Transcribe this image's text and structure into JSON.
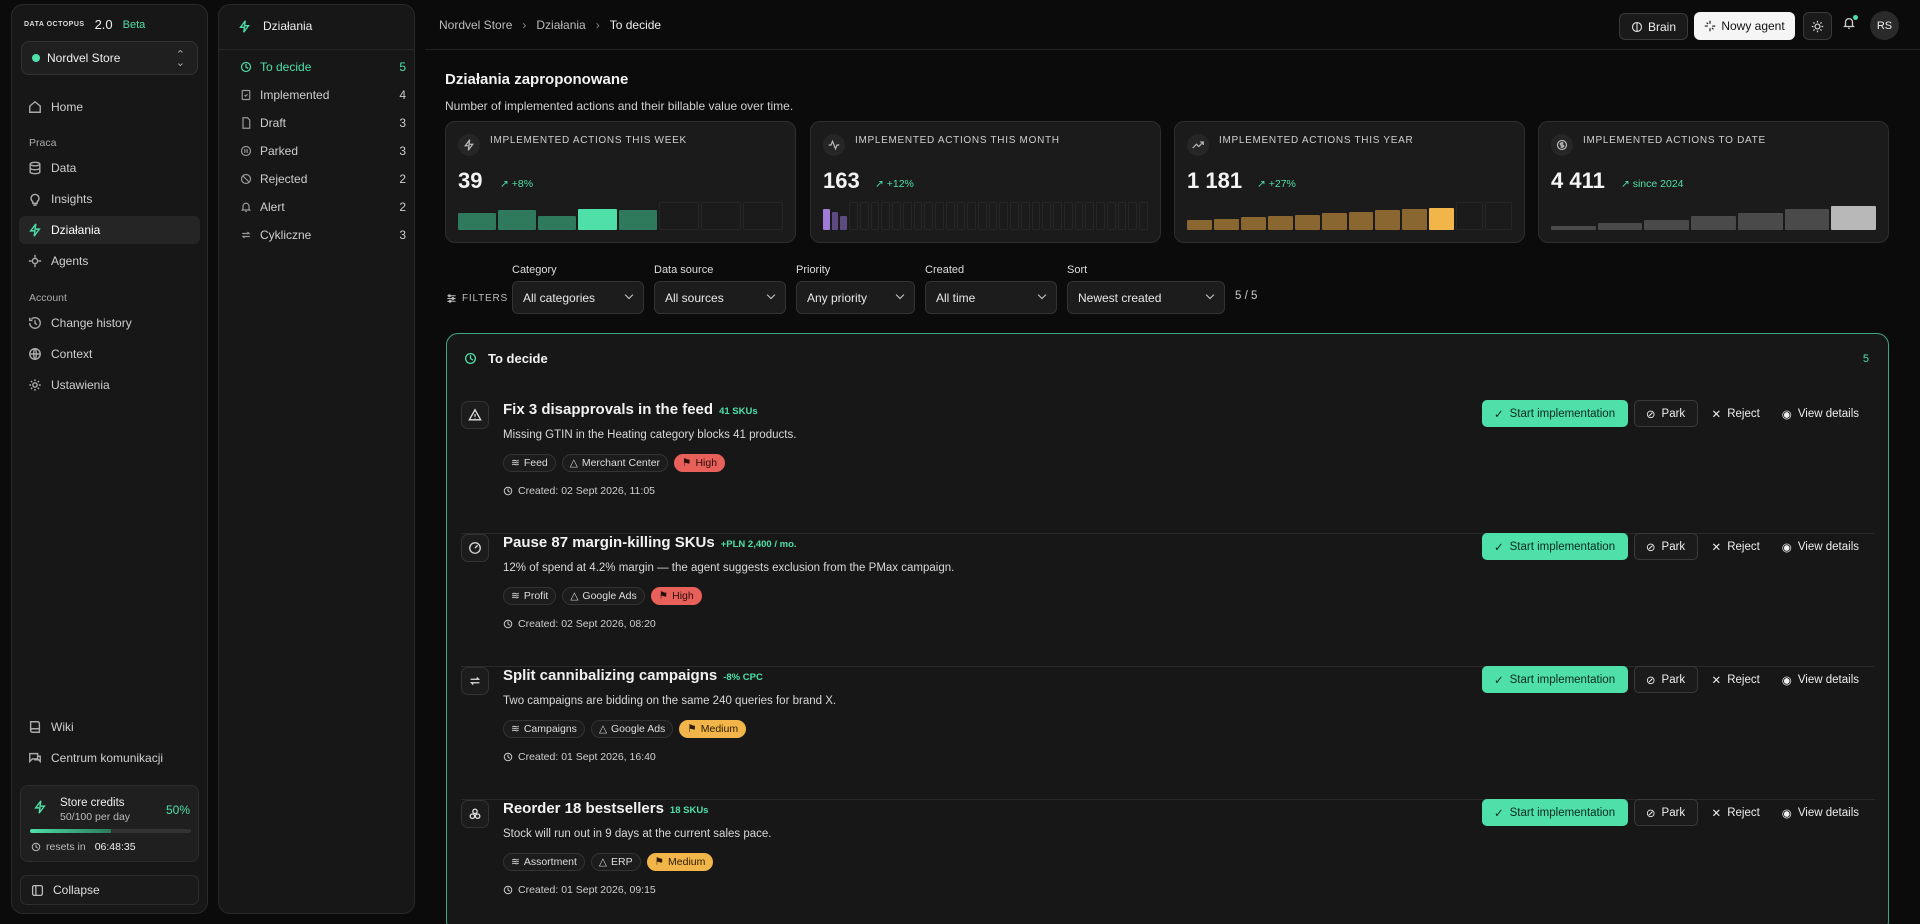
{
  "app": {
    "logo_text": "DATA OCTOPUS",
    "version": "2.0",
    "beta": "Beta",
    "store": "Nordvel Store"
  },
  "sidebar": {
    "items": [
      {
        "label": "Home",
        "icon": "home-icon"
      },
      {
        "label": "Data",
        "icon": "database-icon"
      },
      {
        "label": "Insights",
        "icon": "lightbulb-icon"
      },
      {
        "label": "Działania",
        "icon": "bolt-icon"
      },
      {
        "label": "Agents",
        "icon": "agents-icon"
      },
      {
        "label": "Change history",
        "icon": "history-icon"
      },
      {
        "label": "Context",
        "icon": "globe-icon"
      },
      {
        "label": "Ustawienia",
        "icon": "gear-icon"
      },
      {
        "label": "Wiki",
        "icon": "book-icon"
      },
      {
        "label": "Centrum komunikacji",
        "icon": "chat-icon"
      }
    ],
    "section_praca": "Praca",
    "section_account": "Account",
    "credits": {
      "title": "Store credits",
      "usage": "50/100 per day",
      "percent": "50%",
      "progress": 0.5,
      "reset_label": "resets in",
      "reset_time": "06:48:35"
    },
    "collapse": "Collapse"
  },
  "subnav": {
    "title": "Działania",
    "items": [
      {
        "label": "To decide",
        "count": "5"
      },
      {
        "label": "Implemented",
        "count": "4"
      },
      {
        "label": "Draft",
        "count": "3"
      },
      {
        "label": "Parked",
        "count": "3"
      },
      {
        "label": "Rejected",
        "count": "2"
      },
      {
        "label": "Alert",
        "count": "2"
      },
      {
        "label": "Cykliczne",
        "count": "3"
      }
    ]
  },
  "topbar": {
    "crumbs": [
      "Nordvel Store",
      "Działania",
      "To decide"
    ],
    "brain": "Brain",
    "new_agent": "Nowy agent",
    "avatar": "RS"
  },
  "main": {
    "title": "Działania zaproponowane",
    "subtitle": "Number of implemented actions and their billable value over time.",
    "stats": [
      {
        "label": "Implemented actions this week",
        "value": "39",
        "change": "+8%",
        "color": "#4ee0a8",
        "bars": [
          0.6,
          0.7,
          0.5,
          0.75,
          0.7,
          0,
          0,
          0
        ],
        "dim": "#2f7a5c"
      },
      {
        "label": "Implemented actions this month",
        "value": "163",
        "change": "+12%",
        "color": "#a07cd8",
        "bars": [
          0.75,
          0.65,
          0.5,
          0,
          0,
          0,
          0,
          0,
          0,
          0,
          0,
          0,
          0,
          0,
          0,
          0,
          0,
          0,
          0,
          0,
          0,
          0,
          0,
          0,
          0,
          0,
          0,
          0,
          0,
          0,
          0
        ],
        "dim": "#5c4a80"
      },
      {
        "label": "Implemented actions this year",
        "value": "1 181",
        "change": "+27%",
        "color": "#f2b54a",
        "bars": [
          0.35,
          0.4,
          0.45,
          0.5,
          0.55,
          0.6,
          0.65,
          0.7,
          0.75,
          0.8,
          0,
          0
        ],
        "dim": "#8a6630"
      },
      {
        "label": "Implemented actions to date",
        "value": "4 411",
        "change": "since 2024",
        "color": "#b8b8b8",
        "bars": [
          0.15,
          0.25,
          0.35,
          0.5,
          0.6,
          0.75,
          0.85
        ],
        "dim": "#4a4a4a"
      }
    ],
    "filters": {
      "label": "FILTERS",
      "groups": [
        {
          "label": "Category",
          "value": "All categories"
        },
        {
          "label": "Data source",
          "value": "All sources"
        },
        {
          "label": "Priority",
          "value": "Any priority"
        },
        {
          "label": "Created",
          "value": "All time"
        },
        {
          "label": "Sort",
          "value": "Newest created"
        }
      ],
      "count": "5 / 5"
    },
    "panel": {
      "title": "To decide",
      "count": "5",
      "buttons": {
        "start": "Start implementation",
        "park": "Park",
        "reject": "Reject",
        "details": "View details"
      },
      "cards": [
        {
          "title": "Fix 3 disapprovals in the feed",
          "badge": "41 SKUs",
          "desc": "Missing GTIN in the Heating category blocks 41 products.",
          "tags": [
            "Feed",
            "Merchant Center"
          ],
          "priority": "High",
          "created": "Created: 02 Sept 2026, 11:05",
          "icon": "warning-icon"
        },
        {
          "title": "Pause 87 margin-killing SKUs",
          "badge": "+PLN 2,400 / mo.",
          "desc": "12% of spend at 4.2% margin — the agent suggests exclusion from the PMax campaign.",
          "tags": [
            "Profit",
            "Google Ads"
          ],
          "priority": "High",
          "created": "Created: 02 Sept 2026, 08:20",
          "icon": "gauge-icon"
        },
        {
          "title": "Split cannibalizing campaigns",
          "badge": "-8% CPC",
          "desc": "Two campaigns are bidding on the same 240 queries for brand X.",
          "tags": [
            "Campaigns",
            "Google Ads"
          ],
          "priority": "Medium",
          "created": "Created: 01 Sept 2026, 16:40",
          "icon": "swap-icon"
        },
        {
          "title": "Reorder 18 bestsellers",
          "badge": "18 SKUs",
          "desc": "Stock will run out in 9 days at the current sales pace.",
          "tags": [
            "Assortment",
            "ERP"
          ],
          "priority": "Medium",
          "created": "Created: 01 Sept 2026, 09:15",
          "icon": "boxes-icon"
        }
      ]
    }
  }
}
